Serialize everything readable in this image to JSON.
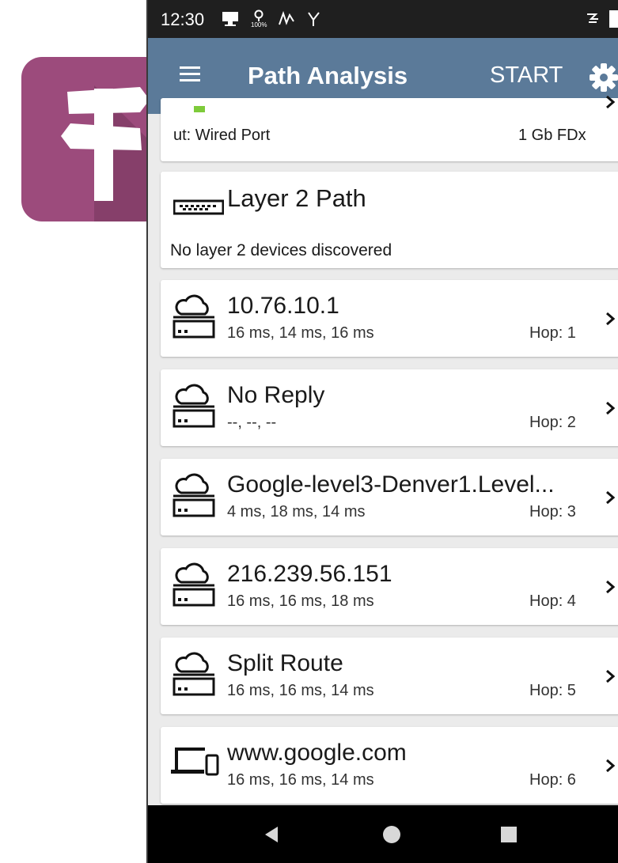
{
  "status_bar": {
    "time": "12:30",
    "battery_text": "100%"
  },
  "app_bar": {
    "title": "Path Analysis",
    "start_label": "START"
  },
  "source_row": {
    "label": "ut:  Wired Port",
    "speed": "1 Gb  FDx"
  },
  "layer2": {
    "title": "Layer 2 Path",
    "message": "No layer 2 devices discovered"
  },
  "hops": [
    {
      "name": "10.76.10.1",
      "times": "16 ms,  14 ms,  16 ms",
      "hop": "Hop:  1",
      "icon": "router-cloud-icon"
    },
    {
      "name": "No Reply",
      "times": "--,  --,  --",
      "hop": "Hop:  2",
      "icon": "router-cloud-icon"
    },
    {
      "name": "Google-level3-Denver1.Level...",
      "times": "4 ms,  18 ms,  14 ms",
      "hop": "Hop:  3",
      "icon": "router-cloud-icon"
    },
    {
      "name": "216.239.56.151",
      "times": "16 ms,  16 ms,  18 ms",
      "hop": "Hop:  4",
      "icon": "router-cloud-icon"
    },
    {
      "name": "Split Route",
      "times": "16 ms,  16 ms,  14 ms",
      "hop": "Hop:  5",
      "icon": "router-cloud-icon"
    },
    {
      "name": "www.google.com",
      "times": "16 ms,  16 ms,  14 ms",
      "hop": "Hop:  6",
      "icon": "devices-icon"
    }
  ],
  "colors": {
    "app_bar": "#5b7a99",
    "logo_bg": "#9c4b7c",
    "status_bar": "#1f1f1f",
    "nav_bar": "#000000"
  }
}
